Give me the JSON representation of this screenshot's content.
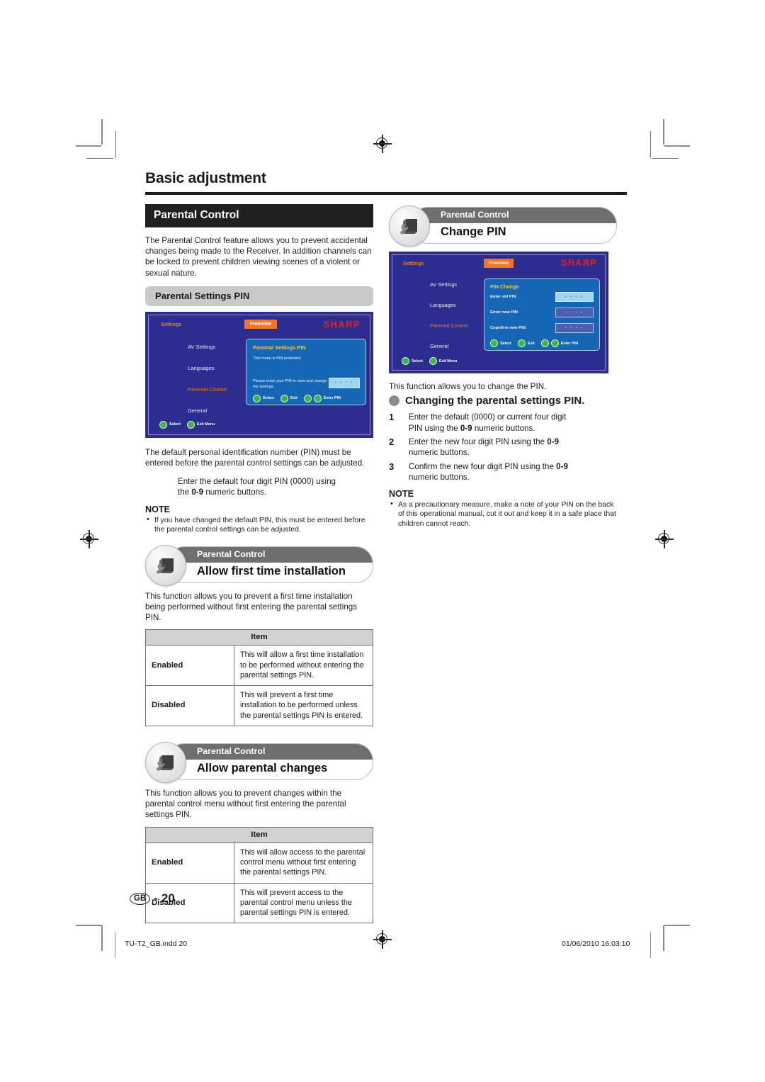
{
  "document": {
    "chapter_title": "Basic adjustment",
    "page_label": "GB",
    "page_number": "20",
    "footer_file": "TU-T2_GB.indd  20",
    "footer_timestamp": "01/06/2010  16:03:10"
  },
  "left_column": {
    "section_header": "Parental Control",
    "intro": "The Parental Control feature allows you to prevent accidental changes being made to the Receiver. In addition channels can be locked to prevent children viewing scenes of a violent or sexual nature.",
    "sub_header": "Parental Settings PIN",
    "after_image_text": "The default personal identification number (PIN) must be entered before the parental control settings can be adjusted.",
    "indent_step_a": "Enter the default four digit PIN (0000) using",
    "indent_step_b_pre": "the ",
    "indent_step_b_bold": "0-9",
    "indent_step_b_post": " numeric buttons.",
    "note_heading": "NOTE",
    "note_items": [
      "If you have changed the default PIN, this must be entered before the parental control settings can be adjusted."
    ],
    "badge_first_install": {
      "eyebrow": "Parental Control",
      "title": "Allow first time installation",
      "description": "This function allows you to prevent a first time installation being performed without first entering the parental settings PIN.",
      "table": {
        "header": "Item",
        "rows": [
          {
            "key": "Enabled",
            "value": "This will allow a first time installation to be performed without entering the parental settings PIN."
          },
          {
            "key": "Disabled",
            "value": "This will prevent a first time installation to be performed unless the parental settings PIN is entered."
          }
        ]
      }
    },
    "badge_parental_changes": {
      "eyebrow": "Parental Control",
      "title": "Allow parental changes",
      "description": "This function allows you to prevent changes within the parental control menu without first entering the parental settings PIN.",
      "table": {
        "header": "Item",
        "rows": [
          {
            "key": "Enabled",
            "value": "This will allow access to the parental control menu without first entering the parental settings PIN."
          },
          {
            "key": "Disabled",
            "value": "This will prevent access to the parental control menu unless the parental settings PIN is entered."
          }
        ]
      }
    }
  },
  "right_column": {
    "badge_change_pin": {
      "eyebrow": "Parental Control",
      "title": "Change PIN"
    },
    "intro": "This function allows you to change the PIN.",
    "bullet_heading": "Changing the parental settings PIN.",
    "steps": [
      {
        "n": "1",
        "a": "Enter the default (0000) or current four digit",
        "b_pre": "PIN using the ",
        "b_bold": "0-9",
        "b_post": " numeric buttons."
      },
      {
        "n": "2",
        "a_pre": "Enter the new four digit PIN using the ",
        "a_bold": "0-9",
        "b": "numeric buttons."
      },
      {
        "n": "3",
        "a_pre": "Confirm the new four digit PIN using the ",
        "a_bold": "0-9",
        "b": "numeric buttons."
      }
    ],
    "note_heading": "NOTE",
    "note_items": [
      "As a precautionary measure, make a note of your PIN on the back of this operational manual, cut it out and keep it in a safe place that children cannot reach."
    ]
  },
  "tv_screen_left": {
    "settings_label": "Settings",
    "freeview_logo": "Freeview",
    "brand_logo": "SHARP",
    "menu_items": [
      {
        "label": "AV Settings",
        "selected": false
      },
      {
        "label": "Languages",
        "selected": false
      },
      {
        "label": "Parental Control",
        "selected": true
      },
      {
        "label": "General",
        "selected": false
      }
    ],
    "panel_title": "Parental Settings PIN",
    "panel_text_1": "This menu is PIN protected.",
    "panel_text_2a": "Please enter your PIN to view and change",
    "panel_text_2b": "the settings.",
    "pin_value": "• • • •",
    "panel_keys": [
      {
        "label": "Select",
        "color": "green",
        "double": false
      },
      {
        "label": "Exit",
        "color": "green",
        "double": false
      },
      {
        "label": "Enter PIN",
        "color": "green",
        "double": true
      }
    ],
    "footer_keys": [
      {
        "label": "Select"
      },
      {
        "label": "Exit Menu"
      }
    ]
  },
  "tv_screen_right": {
    "settings_label": "Settings",
    "freeview_logo": "Freeview",
    "brand_logo": "SHARP",
    "menu_items": [
      {
        "label": "AV Settings",
        "selected": false
      },
      {
        "label": "Languages",
        "selected": false
      },
      {
        "label": "Parental Control",
        "selected": true
      },
      {
        "label": "General",
        "selected": false
      }
    ],
    "panel_title": "PIN Change",
    "fields": [
      {
        "label": "Enter old PIN",
        "value": "• • • •",
        "active": true
      },
      {
        "label": "Enter new PIN",
        "value": "• • • •",
        "active": false
      },
      {
        "label": "Copnfirm new PIN",
        "value": "• • • •",
        "active": false
      }
    ],
    "panel_keys": [
      {
        "label": "Select",
        "color": "green",
        "double": false
      },
      {
        "label": "Exit",
        "color": "green",
        "double": false
      },
      {
        "label": "Enter PIN",
        "color": "green",
        "double": true
      }
    ],
    "footer_keys": [
      {
        "label": "Select"
      },
      {
        "label": "Exit Menu"
      }
    ]
  },
  "colors": {
    "tv_background": "#2d2d8f",
    "tv_panel": "#1566b5",
    "accent_orange": "#f07820",
    "sharp_red": "#e0202a",
    "panel_title_yellow": "#f9c440",
    "header_black": "#231f20",
    "subheader_grey": "#c9c9c9"
  }
}
